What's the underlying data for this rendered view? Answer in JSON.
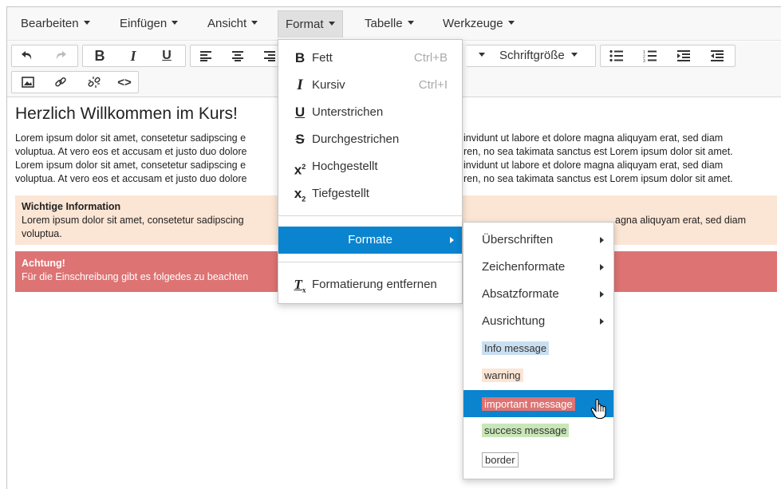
{
  "menubar": {
    "items": [
      {
        "label": "Bearbeiten"
      },
      {
        "label": "Einfügen"
      },
      {
        "label": "Ansicht"
      },
      {
        "label": "Format"
      },
      {
        "label": "Tabelle"
      },
      {
        "label": "Werkzeuge"
      }
    ]
  },
  "toolbar": {
    "font_size_label": "Schriftgröße",
    "icons": [
      "undo-icon",
      "redo-icon",
      "bold-icon",
      "italic-icon",
      "underline-icon",
      "align-left-icon",
      "align-center-icon",
      "align-right-icon",
      "bullet-list-icon",
      "numbered-list-icon",
      "indent-icon",
      "outdent-icon",
      "image-icon",
      "link-icon",
      "unlink-icon",
      "code-icon"
    ]
  },
  "content": {
    "heading": "Herzlich Willkommen im Kurs!",
    "para_lines": [
      "Lorem ipsum dolor sit amet, consetetur sadipscing e",
      "voluptua. At vero eos et accusam et justo duo dolore",
      "Lorem ipsum dolor sit amet, consetetur sadipscing e",
      "voluptua. At vero eos et accusam et justo duo dolore"
    ],
    "para_lines_right": [
      "invidunt ut labore et dolore magna aliquyam erat, sed diam",
      "ren, no sea takimata sanctus est Lorem ipsum dolor sit amet.",
      "invidunt ut labore et dolore magna aliquyam erat, sed diam",
      "ren, no sea takimata sanctus est Lorem ipsum dolor sit amet."
    ],
    "info_title": "Wichtige Information",
    "info_line1_left": "Lorem ipsum dolor sit amet, consetetur sadipscing",
    "info_line1_right": "agna aliquyam erat, sed diam",
    "info_line2": "voluptua.",
    "alert_title": "Achtung!",
    "alert_text": "Für die Einschreibung gibt es folgedes zu beachten"
  },
  "format_menu": {
    "items": [
      {
        "label": "Fett",
        "shortcut": "Ctrl+B",
        "icon": "bold-icon"
      },
      {
        "label": "Kursiv",
        "shortcut": "Ctrl+I",
        "icon": "italic-icon"
      },
      {
        "label": "Unterstrichen",
        "shortcut": "",
        "icon": "underline-icon"
      },
      {
        "label": "Durchgestrichen",
        "shortcut": "",
        "icon": "strikethrough-icon"
      },
      {
        "label": "Hochgestellt",
        "shortcut": "",
        "icon": "superscript-icon"
      },
      {
        "label": "Tiefgestellt",
        "shortcut": "",
        "icon": "subscript-icon"
      }
    ],
    "formats_label": "Formate",
    "clear_label": "Formatierung entfernen"
  },
  "formats_submenu": {
    "items": [
      {
        "label": "Überschriften"
      },
      {
        "label": "Zeichenformate"
      },
      {
        "label": "Absatzformate"
      },
      {
        "label": "Ausrichtung"
      }
    ],
    "chips": [
      {
        "label": "Info message"
      },
      {
        "label": "warning"
      },
      {
        "label": "important message"
      },
      {
        "label": "success message"
      },
      {
        "label": "border"
      }
    ]
  },
  "colors": {
    "accent": "#0a84cf",
    "info": "#c9dff0",
    "warning": "#fbe5d4",
    "important": "#dd7373",
    "success": "#c9e6b8"
  }
}
